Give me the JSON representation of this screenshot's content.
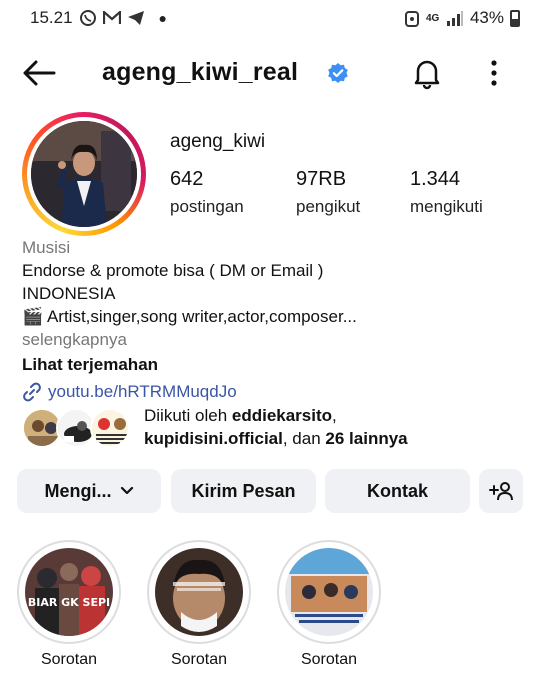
{
  "status_bar": {
    "time": "15.21",
    "network": "4G",
    "battery": "43%"
  },
  "header": {
    "username": "ageng_kiwi_real"
  },
  "profile": {
    "name": "ageng_kiwi",
    "stats": [
      {
        "value": "642",
        "label": "postingan"
      },
      {
        "value": "97RB",
        "label": "pengikut"
      },
      {
        "value": "1.344",
        "label": "mengikuti"
      }
    ],
    "battery_level": 0.43
  },
  "bio": {
    "category": "Musisi",
    "line1": "Endorse & promote bisa ( DM or Email )",
    "line2": "INDONESIA",
    "line3": "🎬 Artist,singer,song writer,actor,composer...",
    "more": "selengkapnya",
    "translate": "Lihat terjemahan",
    "link": "youtu.be/hRTRMMuqdJo"
  },
  "followed_by": {
    "prefix": "Diikuti oleh ",
    "user1": "eddiekarsito",
    "sep": ",",
    "user2": "kupidisini.official",
    "middle": ", dan ",
    "others": "26 lainnya"
  },
  "actions": {
    "following": "Mengi...",
    "message": "Kirim Pesan",
    "contact": "Kontak"
  },
  "highlights": [
    {
      "label": "Sorotan",
      "overlay": "BIAR GK SEPI"
    },
    {
      "label": "Sorotan",
      "overlay": ""
    },
    {
      "label": "Sorotan",
      "overlay": ""
    }
  ]
}
